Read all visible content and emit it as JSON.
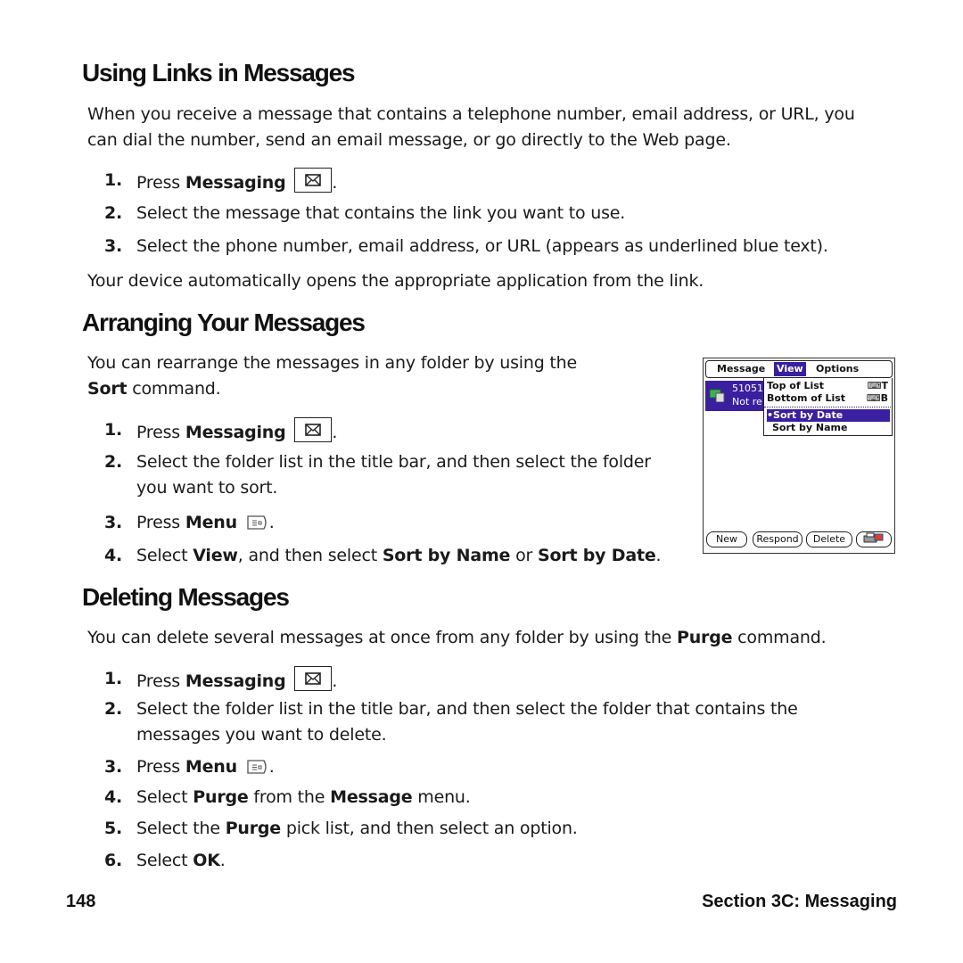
{
  "sections": {
    "links": {
      "heading": "Using Links in Messages",
      "intro_line1": "When you receive a message that contains a telephone number, email address, or URL, you",
      "intro_line2": "can dial the number, send an email message, or go directly to the Web page.",
      "steps": [
        {
          "num": "1.",
          "pre": "Press ",
          "bold": "Messaging",
          "icon": "messaging-key-icon",
          "post": "."
        },
        {
          "num": "2.",
          "text": "Select the message that contains the link you want to use."
        },
        {
          "num": "3.",
          "text": "Select the phone number, email address, or URL (appears as underlined blue text)."
        }
      ],
      "outro": "Your device automatically opens the appropriate application from the link."
    },
    "arranging": {
      "heading": "Arranging Your Messages",
      "intro_line1": "You can rearrange the messages in any folder by using the",
      "intro_bold": "Sort",
      "intro_line2_rest": " command.",
      "steps": [
        {
          "num": "1.",
          "pre": "Press ",
          "bold": "Messaging",
          "icon": "messaging-key-icon",
          "post": "."
        },
        {
          "num": "2.",
          "line1": "Select the folder list in the title bar, and then select the folder",
          "line2": "you want to sort."
        },
        {
          "num": "3.",
          "pre": "Press ",
          "bold": "Menu",
          "icon": "menu-key-icon",
          "post": "."
        },
        {
          "num": "4.",
          "pre": "Select ",
          "bold": "View",
          "mid": ", and then select ",
          "bold2": "Sort by Name",
          "mid2": " or ",
          "bold3": "Sort by Date",
          "post": "."
        }
      ]
    },
    "deleting": {
      "heading": "Deleting Messages",
      "intro_pre": "You can delete several messages at once from any folder by using the ",
      "intro_bold": "Purge",
      "intro_post": " command.",
      "steps": [
        {
          "num": "1.",
          "pre": "Press ",
          "bold": "Messaging",
          "icon": "messaging-key-icon",
          "post": "."
        },
        {
          "num": "2.",
          "line1": "Select the folder list in the title bar, and then select the folder that contains the",
          "line2": "messages you want to delete."
        },
        {
          "num": "3.",
          "pre": "Press ",
          "bold": "Menu",
          "icon": "menu-key-icon",
          "post": "."
        },
        {
          "num": "4.",
          "pre": "Select ",
          "bold": "Purge",
          "mid": " from the ",
          "bold2": "Message",
          "post": " menu."
        },
        {
          "num": "5.",
          "pre": "Select the ",
          "bold": "Purge",
          "post": " pick list, and then select an option."
        },
        {
          "num": "6.",
          "pre": "Select ",
          "bold": "OK",
          "post": "."
        }
      ]
    }
  },
  "device_screen": {
    "menubar": [
      "Message",
      "View",
      "Options"
    ],
    "active_menu": "View",
    "message_row": {
      "line1": "51051",
      "line2": "Not re"
    },
    "dropdown": [
      {
        "label": "Top of List",
        "shortcut": "T"
      },
      {
        "label": "Bottom of List",
        "shortcut": "B"
      },
      {
        "label": "•Sort by Date",
        "selected": true
      },
      {
        "label": "Sort by Name"
      }
    ],
    "buttons": [
      "New",
      "Respond",
      "Delete"
    ],
    "accent_color": "#3a1fa0"
  },
  "footer": {
    "page_number": "148",
    "section": "Section 3C: Messaging"
  }
}
